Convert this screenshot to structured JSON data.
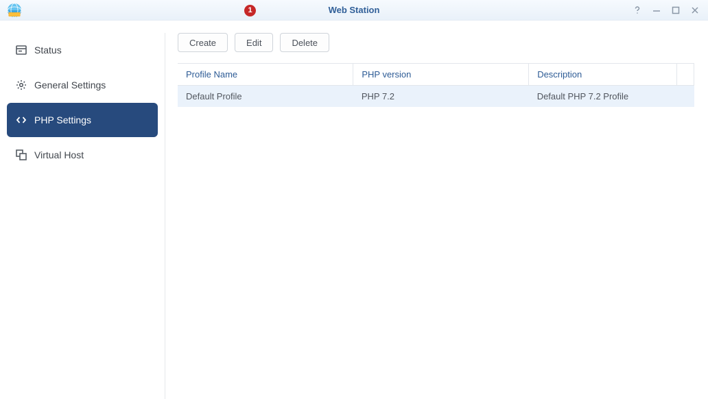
{
  "window": {
    "title": "Web Station"
  },
  "badge": "1",
  "sidebar": {
    "items": [
      {
        "label": "Status"
      },
      {
        "label": "General Settings"
      },
      {
        "label": "PHP Settings"
      },
      {
        "label": "Virtual Host"
      }
    ]
  },
  "toolbar": {
    "create": "Create",
    "edit": "Edit",
    "delete": "Delete"
  },
  "table": {
    "headers": {
      "name": "Profile Name",
      "version": "PHP version",
      "description": "Description"
    },
    "rows": [
      {
        "name": "Default Profile",
        "version": "PHP 7.2",
        "description": "Default PHP 7.2 Profile"
      }
    ]
  }
}
